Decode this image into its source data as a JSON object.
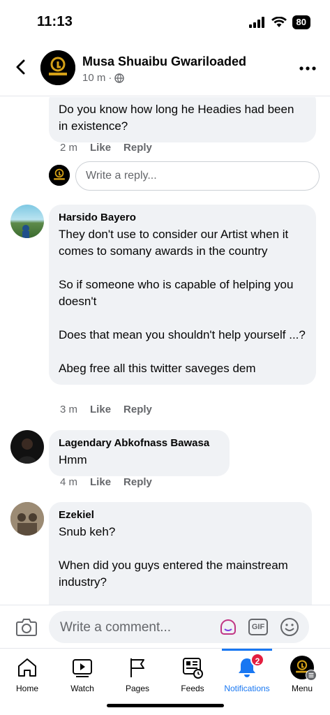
{
  "status": {
    "time": "11:13",
    "battery": "80"
  },
  "header": {
    "name": "Musa Shuaibu Gwariloaded",
    "time": "10 m",
    "sep": "·"
  },
  "logo_text": "GWARILOADED",
  "top_comment": {
    "body": "Do you know how long he Headies had been in existence?",
    "time": "2 m",
    "like": "Like",
    "reply": "Reply"
  },
  "reply_box": {
    "placeholder": "Write a reply..."
  },
  "comments": [
    {
      "author": "Harsido Bayero",
      "body": "They don't use to consider our Artist when it comes to somany awards in the country\n\nSo if someone who is capable of helping you doesn't\n\nDoes that mean you shouldn't help yourself ...?\n\nAbeg free all this twitter saveges dem",
      "time": "3 m",
      "like": "Like",
      "reply": "Reply"
    },
    {
      "author": "Lagendary Abkofnass Bawasa",
      "body": "Hmm",
      "time": "4 m",
      "like": "Like",
      "reply": "Reply"
    },
    {
      "author": "Ezekiel",
      "body": "Snub keh?\n\nWhen did you guys entered the mainstream industry?",
      "time": "",
      "like": "",
      "reply": ""
    }
  ],
  "composer": {
    "placeholder": "Write a comment...",
    "gif_label": "GIF"
  },
  "tabs": {
    "home": "Home",
    "watch": "Watch",
    "pages": "Pages",
    "feeds": "Feeds",
    "notifications": "Notifications",
    "menu": "Menu",
    "notif_count": "2"
  },
  "colors": {
    "accent": "#1877f2",
    "badge": "#e41e3f",
    "bubble": "#f0f2f5"
  }
}
